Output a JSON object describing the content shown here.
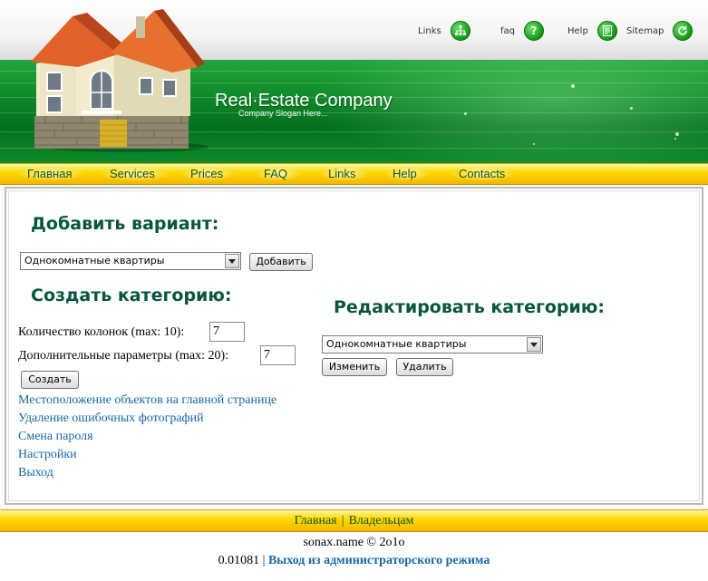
{
  "top_links": [
    {
      "label": "Links",
      "icon": "sitemap-tree-icon"
    },
    {
      "label": "faq",
      "icon": "question-icon"
    },
    {
      "label": "Help",
      "icon": "document-icon"
    },
    {
      "label": "Sitemap",
      "icon": "refresh-icon"
    }
  ],
  "brand": {
    "name": "Real·Estate Company",
    "slogan": "Company Slogan Here..."
  },
  "nav": [
    "Главная",
    "Services",
    "Prices",
    "FAQ",
    "Links",
    "Help",
    "Contacts"
  ],
  "add_variant": {
    "heading": "Добавить вариант:",
    "select_value": "Однокомнатные квартиры",
    "button": "Добавить"
  },
  "create_category": {
    "heading": "Создать категорию:",
    "columns_label": "Количество колонок (max: 10):",
    "columns_value": "7",
    "params_label": "Дополнительные параметры (max: 20):",
    "params_value": "7",
    "button": "Создать"
  },
  "edit_category": {
    "heading": "Редактировать категорию:",
    "select_value": "Однокомнатные квартиры",
    "edit_button": "Изменить",
    "delete_button": "Удалить"
  },
  "admin_links": [
    "Местоположение объектов на главной странице",
    "Удаление ошибочных фотографий",
    "Смена пароля",
    "Настройки",
    "Выход"
  ],
  "footer": {
    "link_home": "Главная",
    "separator": "|",
    "link_owners": "Владельцам",
    "copyright": "sonax.name © 2o1o",
    "version": "0.01081",
    "logout_admin": "Выход из администраторского режима"
  },
  "colors": {
    "green_banner": "#0e8a2a",
    "nav_yellow": "#ffd800",
    "heading_green": "#07573a",
    "link_blue": "#1668a8"
  }
}
